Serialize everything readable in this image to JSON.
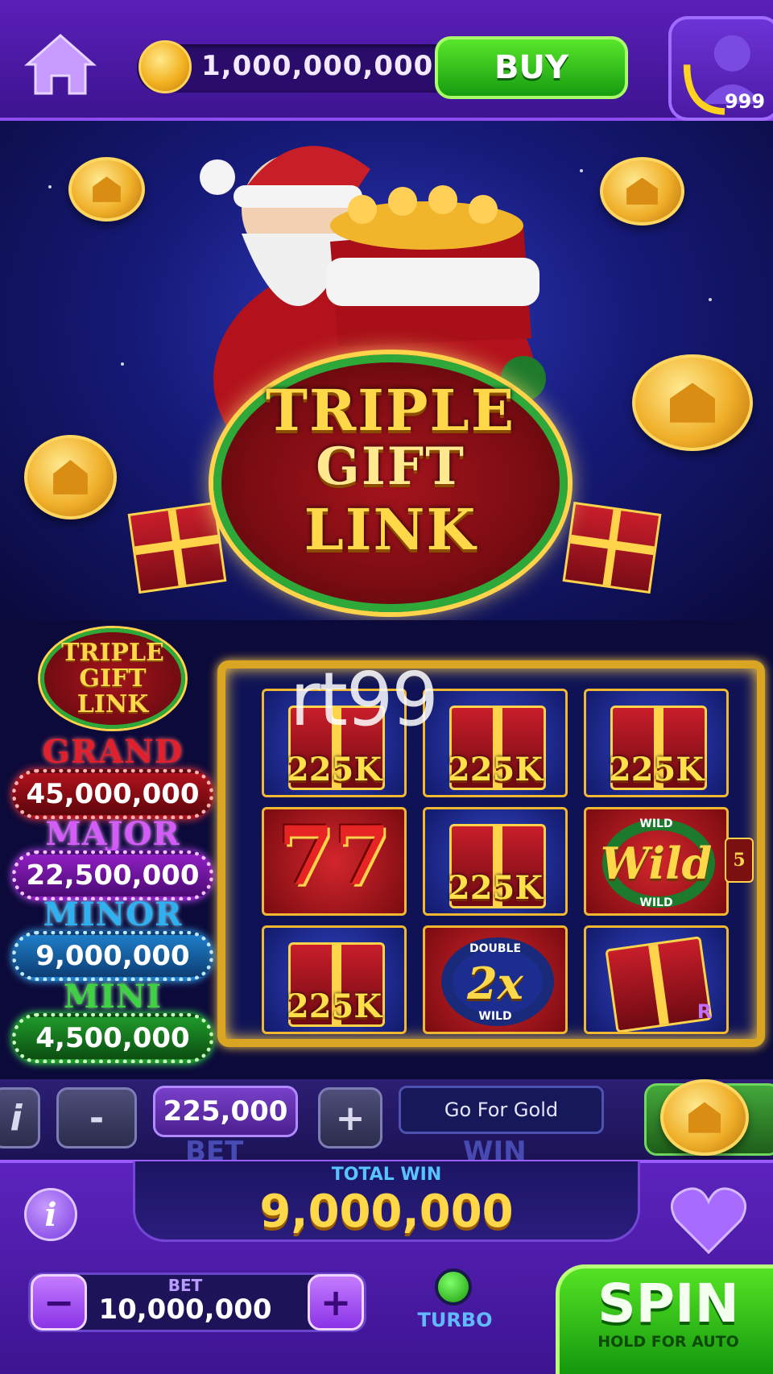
{
  "top_bar": {
    "coin_balance": "1,000,000,000",
    "buy_label": "BUY",
    "level": "999"
  },
  "hero": {
    "logo_lines": [
      "TRIPLE",
      "GIFT",
      "LINK"
    ]
  },
  "jackpots": {
    "logo_lines": [
      "TRIPLE",
      "GIFT",
      "LINK"
    ],
    "items": [
      {
        "label": "GRAND",
        "amount": "45,000,000",
        "color": "#e0202c"
      },
      {
        "label": "MAJOR",
        "amount": "22,500,000",
        "color": "#c33cf0"
      },
      {
        "label": "MINOR",
        "amount": "9,000,000",
        "color": "#2fa7f0"
      },
      {
        "label": "MINI",
        "amount": "4,500,000",
        "color": "#34c23a"
      }
    ]
  },
  "reels": {
    "watermark": "rt99",
    "gift_value": "225K",
    "wild_top": "WILD",
    "wild_word": "Wild",
    "wild_bottom": "WILD",
    "double_top": "DOUBLE",
    "double_word": "2x",
    "double_bottom": "WILD",
    "side_badge": "5",
    "partial_letter": "R"
  },
  "bet_strip": {
    "minus": "-",
    "plus": "+",
    "bet_value": "225,000",
    "message": "Go For Gold",
    "bet_ghost": "BET",
    "win_ghost": "WIN"
  },
  "bottom": {
    "total_win_label": "TOTAL WIN",
    "total_win_value": "9,000,000",
    "info_label": "i",
    "bet_label": "BET",
    "bet_value": "10,000,000",
    "bet_minus": "−",
    "bet_plus": "+",
    "turbo_label": "TURBO",
    "spin_label": "SPIN",
    "spin_sub": "HOLD FOR AUTO"
  },
  "colors": {
    "accent_purple": "#5c23bd",
    "spin_green": "#14970e",
    "gold": "#ffd84a"
  }
}
